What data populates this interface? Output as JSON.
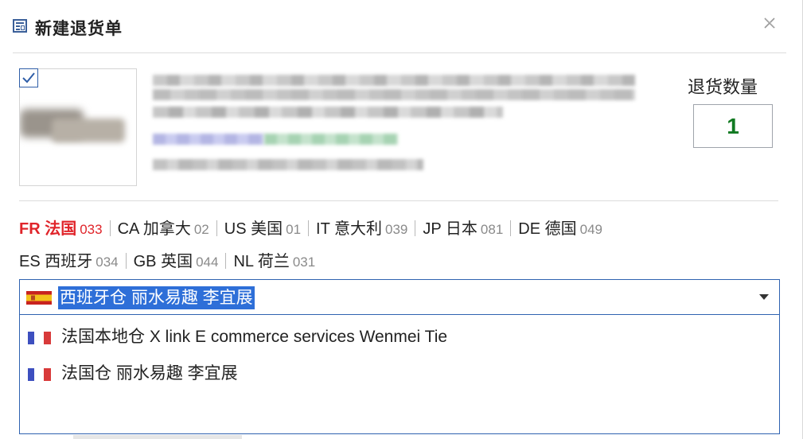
{
  "window": {
    "title": "新建退货单",
    "icon": "form-icon",
    "close_icon": "close-icon"
  },
  "product": {
    "checked": true,
    "quantity_label": "退货数量",
    "quantity_value": "1"
  },
  "countries": [
    {
      "code_name": "FR 法国",
      "count": "033",
      "active": true
    },
    {
      "code_name": "CA 加拿大",
      "count": "02",
      "active": false
    },
    {
      "code_name": "US 美国",
      "count": "01",
      "active": false
    },
    {
      "code_name": "IT 意大利",
      "count": "039",
      "active": false
    },
    {
      "code_name": "JP 日本",
      "count": "081",
      "active": false
    },
    {
      "code_name": "DE 德国",
      "count": "049",
      "active": false
    },
    {
      "code_name": "ES 西班牙",
      "count": "034",
      "active": false
    },
    {
      "code_name": "GB 英国",
      "count": "044",
      "active": false
    },
    {
      "code_name": "NL 荷兰",
      "count": "031",
      "active": false
    }
  ],
  "warehouse_select": {
    "selected_flag": "spain-flag-icon",
    "selected_value": "西班牙仓 丽水易趣 李宜展",
    "options": [
      {
        "flag": "france-flag-icon",
        "label": "法国本地仓 X link E commerce services Wenmei Tie"
      },
      {
        "flag": "france-flag-icon",
        "label": "法国仓 丽水易趣 李宜展"
      }
    ]
  },
  "colors": {
    "accent": "#2e6fd8",
    "active_country": "#e0242a",
    "quantity": "#127a22"
  }
}
